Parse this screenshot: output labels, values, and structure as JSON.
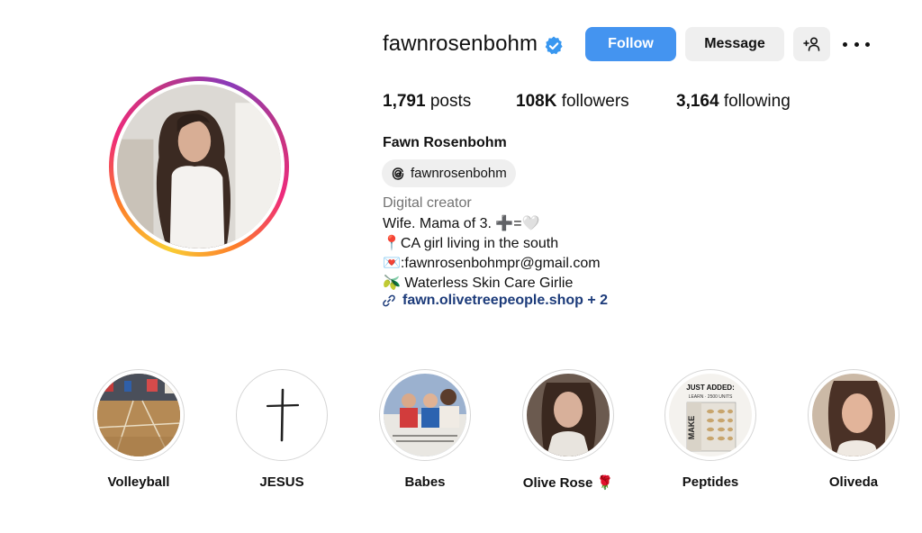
{
  "profile": {
    "username": "fawnrosenbohm",
    "display_name": "Fawn Rosenbohm",
    "threads_handle": "fawnrosenbohm",
    "category": "Digital creator",
    "verified": true
  },
  "actions": {
    "follow_label": "Follow",
    "message_label": "Message"
  },
  "stats": {
    "posts_count": "1,791",
    "posts_label": "posts",
    "followers_count": "108K",
    "followers_label": "followers",
    "following_count": "3,164",
    "following_label": "following"
  },
  "bio": {
    "line1": "Wife. Mama of 3. ➕=🤍",
    "line2": "📍CA girl living in the south",
    "line3": "💌:fawnrosenbohmpr@gmail.com",
    "line4": "🫒 Waterless Skin Care Girlie",
    "link_text": "fawn.olivetreepeople.shop + 2"
  },
  "highlights": [
    {
      "label": "Volleyball"
    },
    {
      "label": "JESUS"
    },
    {
      "label": "Babes"
    },
    {
      "label": "Olive Rose 🌹"
    },
    {
      "label": "Peptides"
    },
    {
      "label": "Oliveda"
    }
  ],
  "peptides_cover_text": {
    "heading": "JUST ADDED:",
    "sub": "LEARN · 2500 UNITS",
    "brand": "MAKE"
  },
  "colors": {
    "follow_blue": "#4494f0",
    "verified_blue": "#3897f0",
    "link_blue": "#1c3b7a",
    "secondary_gray": "#737373",
    "button_gray": "#efefef"
  },
  "icons": {
    "verified": "verified-badge-icon",
    "add_user": "add-user-icon",
    "more": "more-options-icon",
    "threads": "threads-icon",
    "link": "link-icon"
  }
}
